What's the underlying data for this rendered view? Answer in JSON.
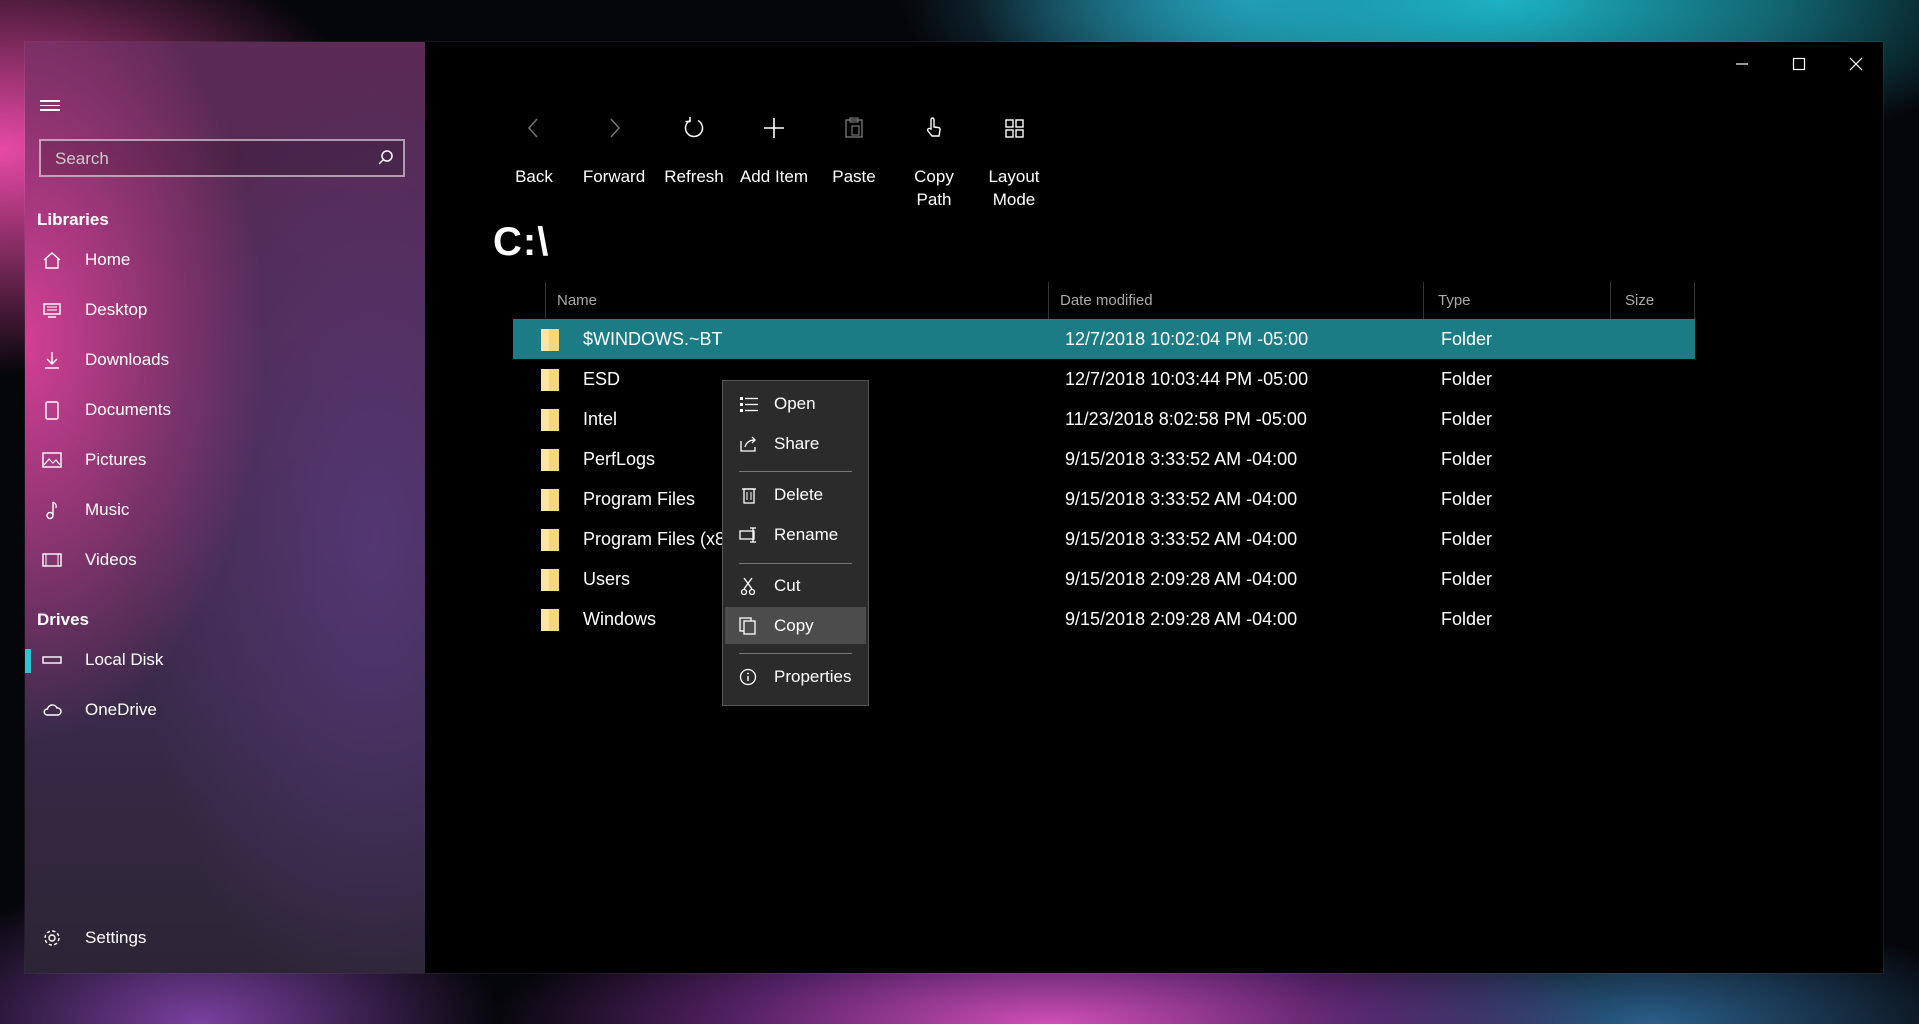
{
  "window": {
    "caption": {
      "minimize": "minimize",
      "maximize": "maximize",
      "close": "close"
    }
  },
  "sidebar": {
    "search_placeholder": "Search",
    "libraries_label": "Libraries",
    "libraries": [
      {
        "label": "Home",
        "icon": "home-icon"
      },
      {
        "label": "Desktop",
        "icon": "desktop-icon"
      },
      {
        "label": "Downloads",
        "icon": "download-icon"
      },
      {
        "label": "Documents",
        "icon": "document-icon"
      },
      {
        "label": "Pictures",
        "icon": "picture-icon"
      },
      {
        "label": "Music",
        "icon": "music-icon"
      },
      {
        "label": "Videos",
        "icon": "video-icon"
      }
    ],
    "drives_label": "Drives",
    "drives": [
      {
        "label": "Local Disk",
        "icon": "drive-icon",
        "selected": true
      },
      {
        "label": "OneDrive",
        "icon": "cloud-icon"
      }
    ],
    "settings_label": "Settings"
  },
  "toolbar": {
    "back": "Back",
    "forward": "Forward",
    "refresh": "Refresh",
    "add_item": "Add Item",
    "paste": "Paste",
    "copy_path_1": "Copy",
    "copy_path_2": "Path",
    "layout_mode_1": "Layout",
    "layout_mode_2": "Mode"
  },
  "path": "C:\\",
  "columns": {
    "name": "Name",
    "date": "Date modified",
    "type": "Type",
    "size": "Size"
  },
  "files": [
    {
      "name": "$WINDOWS.~BT",
      "date": "12/7/2018 10:02:04 PM -05:00",
      "type": "Folder",
      "selected": true
    },
    {
      "name": "ESD",
      "date": "12/7/2018 10:03:44 PM -05:00",
      "type": "Folder"
    },
    {
      "name": "Intel",
      "date": "11/23/2018 8:02:58 PM -05:00",
      "type": "Folder"
    },
    {
      "name": "PerfLogs",
      "date": "9/15/2018 3:33:52 AM -04:00",
      "type": "Folder"
    },
    {
      "name": "Program Files",
      "date": "9/15/2018 3:33:52 AM -04:00",
      "type": "Folder"
    },
    {
      "name": "Program Files (x86)",
      "date": "9/15/2018 3:33:52 AM -04:00",
      "type": "Folder"
    },
    {
      "name": "Users",
      "date": "9/15/2018 2:09:28 AM -04:00",
      "type": "Folder"
    },
    {
      "name": "Windows",
      "date": "9/15/2018 2:09:28 AM -04:00",
      "type": "Folder"
    }
  ],
  "context_menu": {
    "open": "Open",
    "share": "Share",
    "delete": "Delete",
    "rename": "Rename",
    "cut": "Cut",
    "copy": "Copy",
    "properties": "Properties"
  },
  "colors": {
    "accent": "#2ec5d3",
    "selection": "#1c7c86",
    "folder": "#f6d77a",
    "menu_bg": "#2b2b2b",
    "menu_highlight": "#4c4c4c"
  }
}
